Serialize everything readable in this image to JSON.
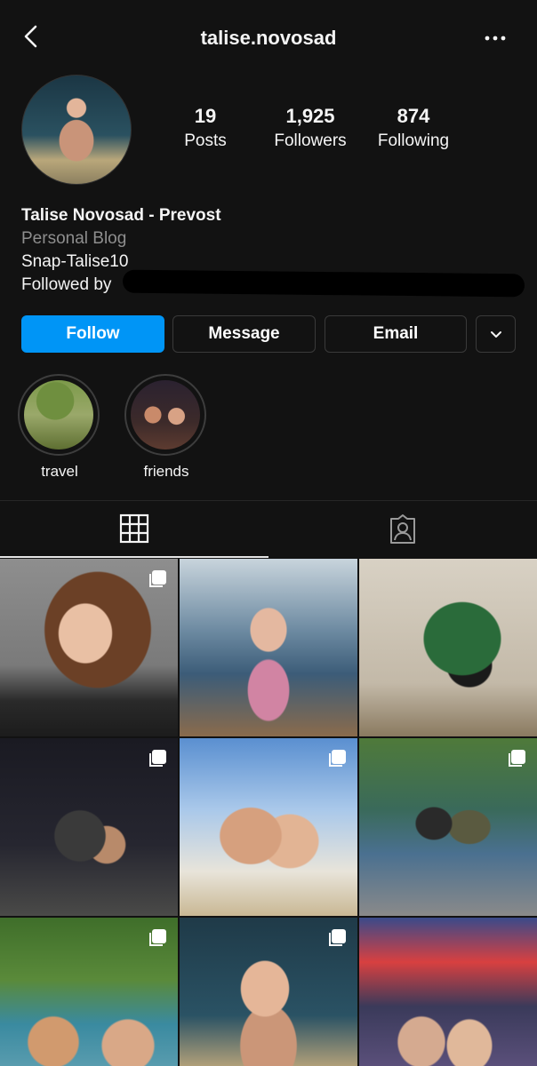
{
  "header": {
    "username": "talise.novosad",
    "back_icon": "chevron-left-icon",
    "more_icon": "more-horizontal-icon"
  },
  "stats": {
    "posts": {
      "value": "19",
      "label": "Posts"
    },
    "followers": {
      "value": "1,925",
      "label": "Followers"
    },
    "following": {
      "value": "874",
      "label": "Following"
    }
  },
  "bio": {
    "name": "Talise Novosad - Prevost",
    "category": "Personal Blog",
    "snap": "Snap-Talise10",
    "followed_by": "Followed by"
  },
  "actions": {
    "follow": "Follow",
    "message": "Message",
    "email": "Email"
  },
  "highlights": [
    {
      "label": "travel"
    },
    {
      "label": "friends"
    }
  ],
  "tabs": {
    "grid_icon": "grid-icon",
    "tagged_icon": "tagged-person-icon"
  },
  "colors": {
    "background": "#121212",
    "follow_button": "#0095f6",
    "secondary_text": "#8e8e8e"
  },
  "grid": {
    "posts": [
      {
        "multi": true
      },
      {
        "multi": false
      },
      {
        "multi": false
      },
      {
        "multi": true
      },
      {
        "multi": true
      },
      {
        "multi": true
      },
      {
        "multi": true
      },
      {
        "multi": true
      },
      {
        "multi": false
      }
    ]
  }
}
